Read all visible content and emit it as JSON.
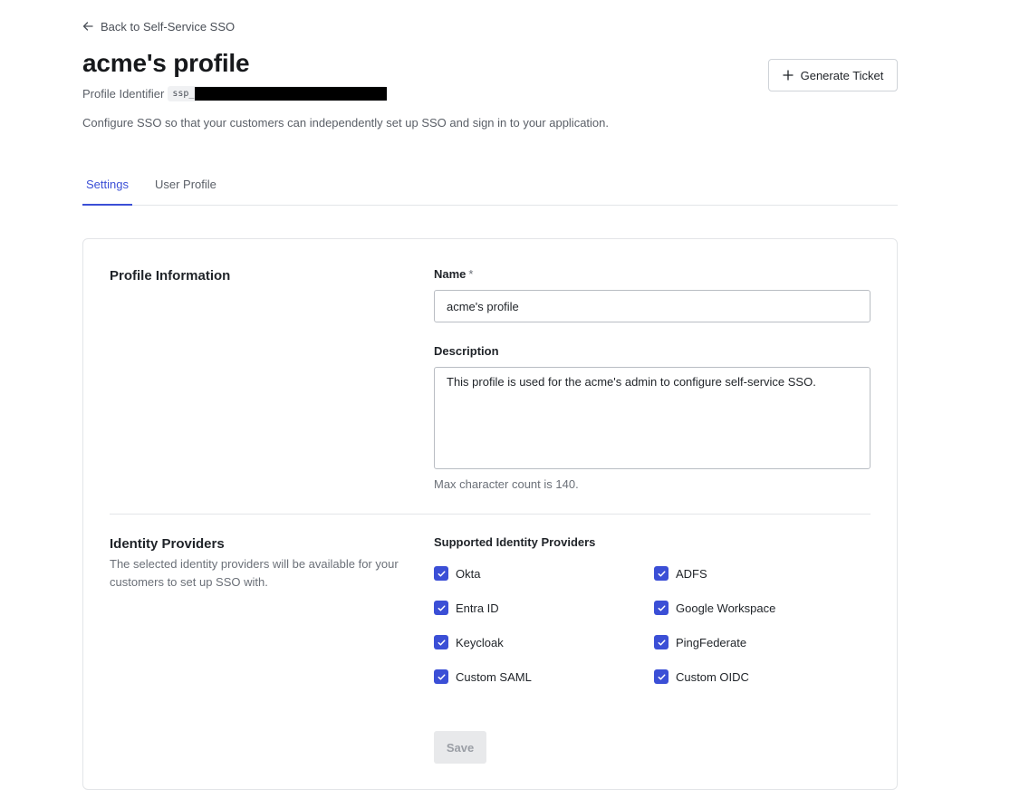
{
  "nav": {
    "back_label": "Back to Self-Service SSO"
  },
  "header": {
    "title": "acme's profile",
    "profile_identifier_label": "Profile Identifier",
    "profile_identifier_prefix": "ssp_",
    "generate_ticket_label": "Generate Ticket",
    "description": "Configure SSO so that your customers can independently set up SSO and sign in to your application."
  },
  "tabs": [
    {
      "label": "Settings",
      "active": true
    },
    {
      "label": "User Profile",
      "active": false
    }
  ],
  "profile_information": {
    "title": "Profile Information",
    "name_label": "Name",
    "name_required_mark": "*",
    "name_value": "acme's profile",
    "description_label": "Description",
    "description_value": "This profile is used for the acme's admin to configure self-service SSO.",
    "description_hint": "Max character count is 140."
  },
  "identity_providers": {
    "title": "Identity Providers",
    "subtitle": "The selected identity providers will be available for your customers to set up SSO with.",
    "supported_label": "Supported Identity Providers",
    "items": [
      {
        "label": "Okta",
        "checked": true
      },
      {
        "label": "ADFS",
        "checked": true
      },
      {
        "label": "Entra ID",
        "checked": true
      },
      {
        "label": "Google Workspace",
        "checked": true
      },
      {
        "label": "Keycloak",
        "checked": true
      },
      {
        "label": "PingFederate",
        "checked": true
      },
      {
        "label": "Custom SAML",
        "checked": true
      },
      {
        "label": "Custom OIDC",
        "checked": true
      }
    ]
  },
  "actions": {
    "save_label": "Save"
  },
  "colors": {
    "accent": "#3b4fd6",
    "border": "#e3e5e8",
    "muted_text": "#6b7078"
  },
  "icons": {
    "back": "arrow-left-icon",
    "generate": "plus-icon",
    "check": "checkmark-icon"
  }
}
